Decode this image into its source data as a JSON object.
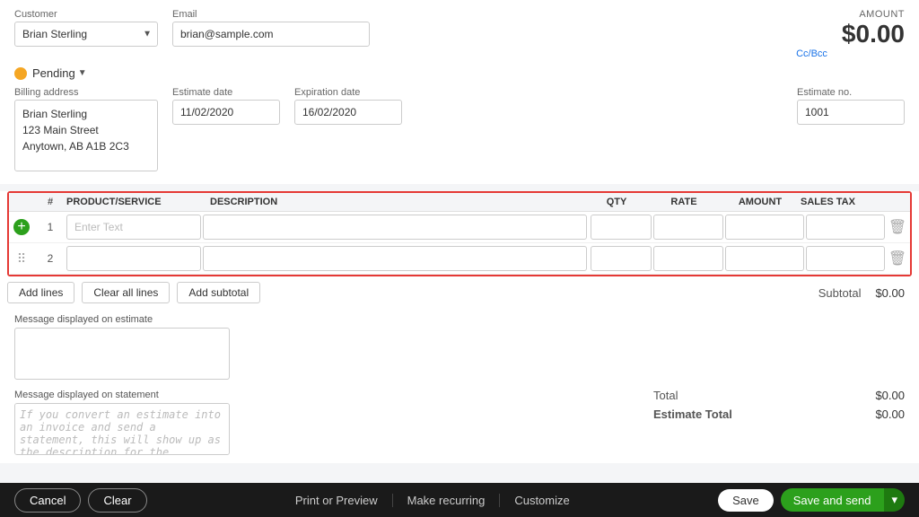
{
  "header": {
    "amount_label": "AMOUNT",
    "amount_value": "$0.00"
  },
  "form": {
    "customer_label": "Customer",
    "customer_value": "Brian Sterling",
    "email_label": "Email",
    "email_value": "brian@sample.com",
    "cc_bcc": "Cc/Bcc",
    "status_value": "Pending",
    "billing_label": "Billing address",
    "billing_address": "Brian Sterling\n123 Main Street\nAnytown, AB A1B 2C3",
    "estimate_date_label": "Estimate date",
    "estimate_date_value": "11/02/2020",
    "expiration_date_label": "Expiration date",
    "expiration_date_value": "16/02/2020",
    "estimate_no_label": "Estimate no.",
    "estimate_no_value": "1001"
  },
  "table": {
    "col_num": "#",
    "col_product": "PRODUCT/SERVICE",
    "col_desc": "DESCRIPTION",
    "col_qty": "QTY",
    "col_rate": "RATE",
    "col_amount": "AMOUNT",
    "col_salestax": "SALES TAX",
    "row1_num": "1",
    "row1_product_placeholder": "Enter Text",
    "row2_num": "2"
  },
  "table_actions": {
    "add_lines": "Add lines",
    "clear_all": "Clear all lines",
    "add_subtotal": "Add subtotal"
  },
  "messages": {
    "estimate_label": "Message displayed on estimate",
    "statement_label": "Message displayed on statement",
    "statement_placeholder": "If you convert an estimate into an invoice and send a statement, this will show up as the description for the invoice."
  },
  "totals": {
    "subtotal_label": "Subtotal",
    "subtotal_value": "$0.00",
    "total_label": "Total",
    "total_value": "$0.00",
    "estimate_total_label": "Estimate Total",
    "estimate_total_value": "$0.00"
  },
  "footer": {
    "cancel_label": "Cancel",
    "clear_label": "Clear",
    "print_preview_label": "Print or Preview",
    "make_recurring_label": "Make recurring",
    "customize_label": "Customize",
    "save_label": "Save",
    "save_send_label": "Save and send",
    "more_label": "▾"
  }
}
